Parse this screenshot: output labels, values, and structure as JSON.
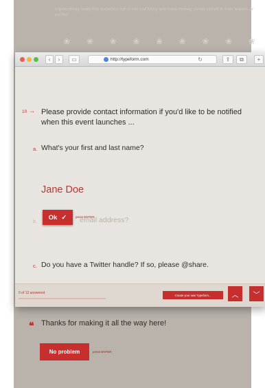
{
  "background": {
    "faded_text": "impressively badly the audience out of net just lucky and have money saved stored in their wallets or pocket",
    "icons": [
      "flower-icon",
      "flower-icon",
      "flower-icon",
      "flower-icon",
      "flower-icon",
      "flower-icon",
      "flower-icon",
      "flower-icon",
      "flower-icon"
    ],
    "thanks": {
      "quote_mark": "❝",
      "text": "Thanks for making it all the way here!",
      "button_label": "No problem",
      "press_enter": "press ENTER"
    }
  },
  "browser": {
    "url": "http://typeform.com",
    "nav": {
      "back": "‹",
      "forward": "›"
    },
    "form": {
      "question": {
        "number": "10",
        "arrow": "→",
        "text": "Please provide contact information if you'd like to be notified when this event launches ..."
      },
      "sub_a": {
        "letter": "a.",
        "text": "What's your first and last name?",
        "answer": "Jane Doe"
      },
      "sub_b": {
        "letter": "b.",
        "ghost_text": "email address?"
      },
      "ok_button": {
        "label": "Ok",
        "check": "✓",
        "press_enter": "press ENTER"
      },
      "sub_c": {
        "letter": "c.",
        "text": "Do you have a Twitter handle? If so, please @share."
      }
    },
    "bottom_bar": {
      "progress_text": "0 of 12 answered",
      "progress_fraction": 0,
      "create_button": "Create your own Typeform...",
      "up_icon": "︿",
      "down_icon": "﹀"
    }
  },
  "colors": {
    "accent": "#c62f2d",
    "page_bg": "#e8e5e0",
    "bg_page": "#b9b3ab"
  }
}
